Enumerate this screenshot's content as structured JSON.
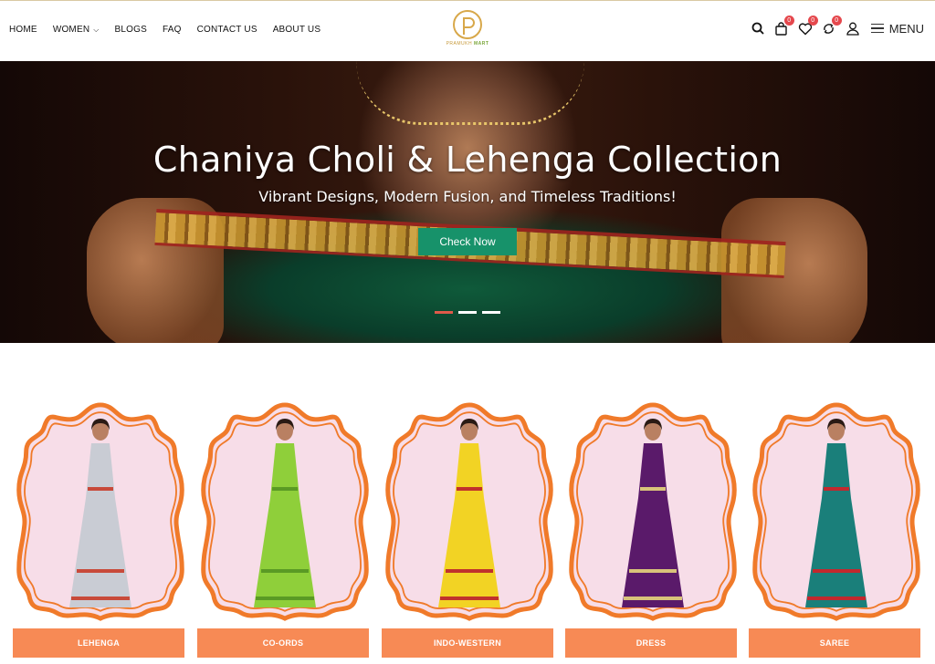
{
  "nav": {
    "items": [
      {
        "label": "HOME"
      },
      {
        "label": "WOMEN"
      },
      {
        "label": "BLOGS"
      },
      {
        "label": "FAQ"
      },
      {
        "label": "CONTACT US"
      },
      {
        "label": "ABOUT US"
      }
    ]
  },
  "brand": {
    "logo_text_1": "PRAMUKH",
    "logo_text_2": "MART",
    "accent": "#c79a3b"
  },
  "header_icons": {
    "cart_count": "0",
    "wishlist_count": "0",
    "compare_count": "0",
    "menu_label": "MENU"
  },
  "hero": {
    "title": "Chaniya Choli & Lehenga Collection",
    "subtitle": "Vibrant Designs, Modern Fusion, and Timeless Traditions!",
    "cta": "Check Now",
    "slides": 3,
    "active_slide": 1,
    "cta_color": "#17926a"
  },
  "categories": [
    {
      "label": "LEHENGA",
      "dress": "#c9ccd4",
      "accent": "#c84a3a"
    },
    {
      "label": "CO-ORDS",
      "dress": "#8fcf3a",
      "accent": "#5a9a24"
    },
    {
      "label": "INDO-WESTERN",
      "dress": "#f2d324",
      "accent": "#c0322c"
    },
    {
      "label": "DRESS",
      "dress": "#5a1a6a",
      "accent": "#d8c37a"
    },
    {
      "label": "SAREE",
      "dress": "#1a7f7a",
      "accent": "#c2282e"
    }
  ],
  "colors": {
    "frame_orange": "#f07a2a",
    "frame_fill": "#f7dde8",
    "label_bg": "#f78a55"
  }
}
